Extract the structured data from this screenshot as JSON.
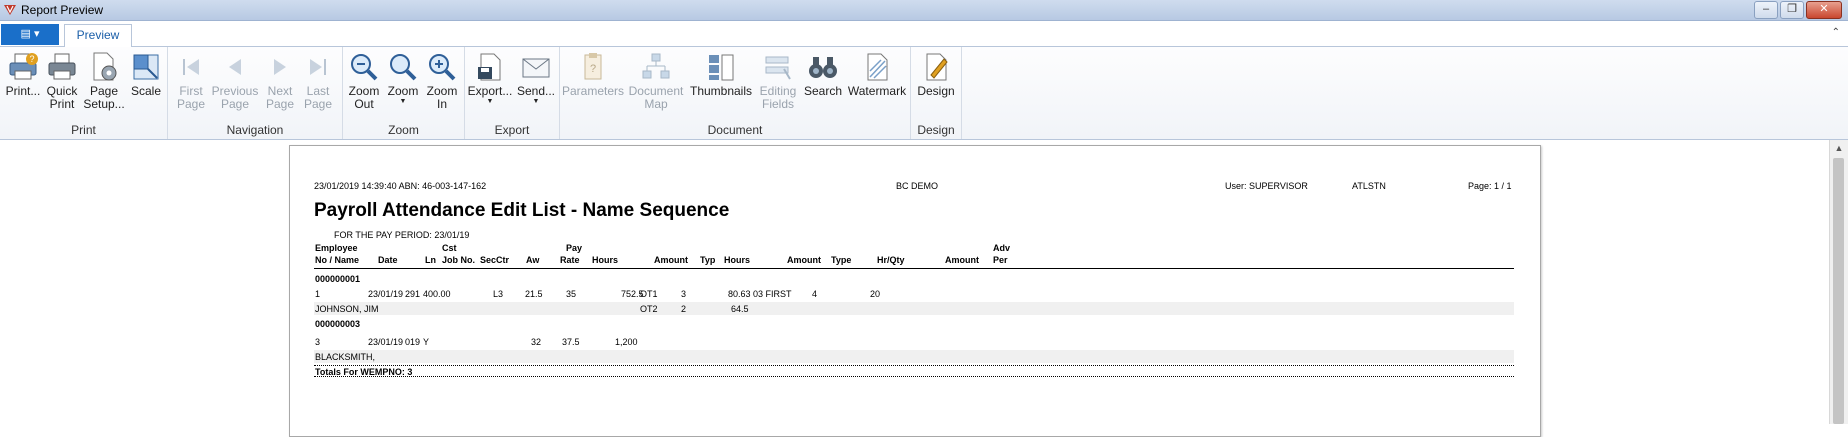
{
  "window": {
    "title": "Report Preview"
  },
  "tabs": {
    "app_menu_icon": "menu-icon",
    "preview": "Preview"
  },
  "ribbon": {
    "print_group": {
      "label": "Print",
      "print": "Print...",
      "quick_print": [
        "Quick",
        "Print"
      ],
      "page_setup": [
        "Page",
        "Setup..."
      ],
      "scale": "Scale"
    },
    "navigation_group": {
      "label": "Navigation",
      "first_page": [
        "First",
        "Page"
      ],
      "previous_page": [
        "Previous",
        "Page"
      ],
      "next_page": [
        "Next",
        "Page"
      ],
      "last_page": [
        "Last",
        "Page"
      ]
    },
    "zoom_group": {
      "label": "Zoom",
      "zoom_out": [
        "Zoom",
        "Out"
      ],
      "zoom": "Zoom",
      "zoom_in": [
        "Zoom",
        "In"
      ]
    },
    "export_group": {
      "label": "Export",
      "export": "Export...",
      "send": "Send..."
    },
    "document_group": {
      "label": "Document",
      "parameters": "Parameters",
      "document_map": [
        "Document",
        "Map"
      ],
      "thumbnails": "Thumbnails",
      "editing_fields": [
        "Editing",
        "Fields"
      ],
      "search": "Search",
      "watermark": "Watermark"
    },
    "design_group": {
      "label": "Design",
      "design": "Design"
    }
  },
  "report": {
    "header_left": "23/01/2019 14:39:40   ABN: 46-003-147-162",
    "company": "BC DEMO",
    "user": "User: SUPERVISOR",
    "site": "ATLSTN",
    "page": "Page: 1 / 1",
    "title": "Payroll Attendance Edit List - Name Sequence",
    "period": "FOR THE PAY PERIOD: 23/01/19",
    "columns": {
      "employee": "Employee",
      "no_name": "No / Name",
      "date": "Date",
      "ln": "Ln",
      "cst": "Cst",
      "job_no": "Job No.",
      "secctr": "SecCtr",
      "aw": "Aw",
      "pay": "Pay",
      "rate": "Rate",
      "hours": "Hours",
      "amount": "Amount",
      "typ": "Typ",
      "hours2": "Hours",
      "amount2": "Amount",
      "type": "Type",
      "hr_qty": "Hr/Qty",
      "amount3": "Amount",
      "adv": "Adv",
      "per": "Per"
    },
    "employees": [
      {
        "id": "000000001",
        "no": "1",
        "date": "23/01/19",
        "ln": "291",
        "job": "400.00",
        "aw": "L3",
        "rate": "21.5",
        "hours": "35",
        "amount": "752.5",
        "ot1_typ": "OT1",
        "ot1_hours": "3",
        "ot1_amount": "80.63",
        "type": "03 FIRST",
        "hr_qty": "4",
        "amount3": "20",
        "name": "JOHNSON, JIM",
        "ot2_typ": "OT2",
        "ot2_hours": "2",
        "ot2_amount": "64.5"
      },
      {
        "id": "000000003",
        "no": "3",
        "date": "23/01/19",
        "ln": "019",
        "job": "Y",
        "rate": "32",
        "hours": "37.5",
        "amount": "1,200",
        "name": "BLACKSMITH,"
      }
    ],
    "totals_label": "Totals For WEMPNO: 3"
  }
}
